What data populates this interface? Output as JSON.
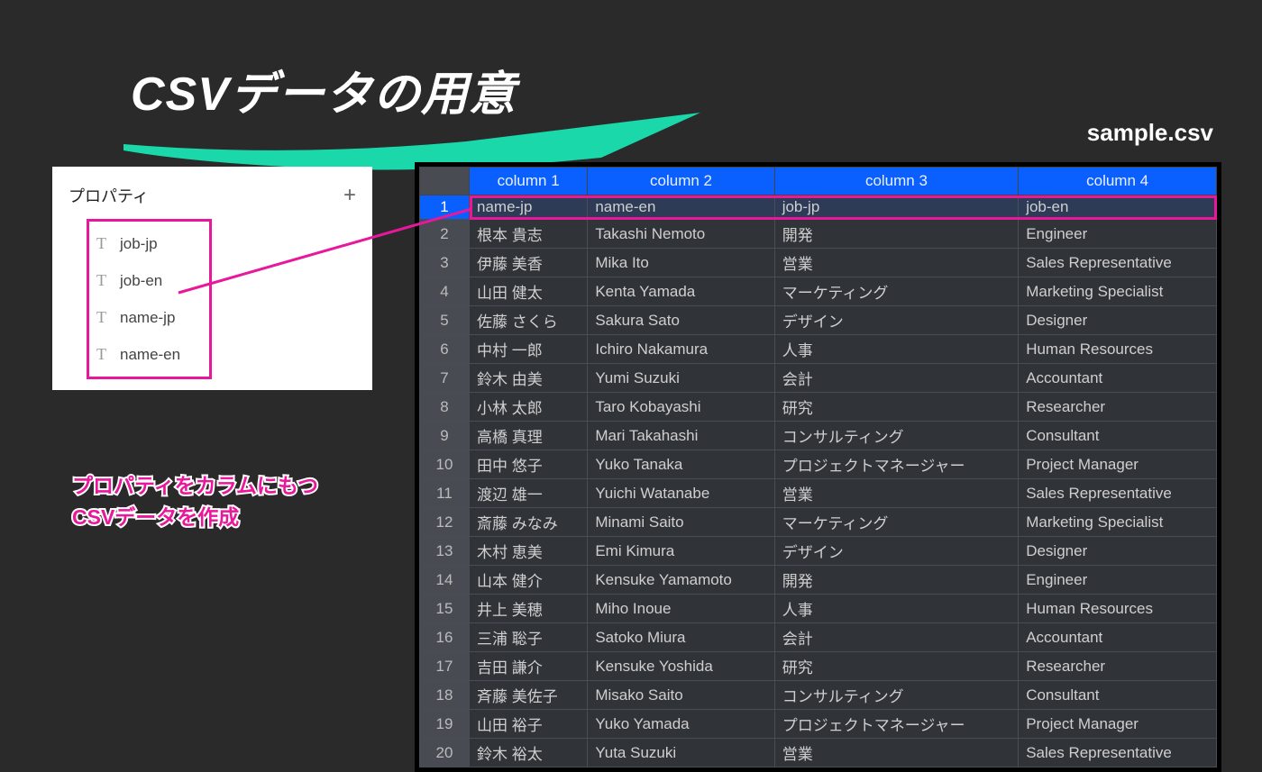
{
  "title": "CSVデータの用意",
  "filename": "sample.csv",
  "properties": {
    "header": "プロパティ",
    "items": [
      "job-jp",
      "job-en",
      "name-jp",
      "name-en"
    ]
  },
  "caption_line1": "プロパティをカラムにもつ",
  "caption_line2": "CSVデータを作成",
  "columns": [
    "column 1",
    "column 2",
    "column 3",
    "column 4"
  ],
  "rows": [
    {
      "n": "1",
      "c": [
        "name-jp",
        "name-en",
        "job-jp",
        "job-en"
      ],
      "hl": true
    },
    {
      "n": "2",
      "c": [
        "根本 貴志",
        "Takashi Nemoto",
        "開発",
        "Engineer"
      ]
    },
    {
      "n": "3",
      "c": [
        "伊藤 美香",
        "Mika Ito",
        "営業",
        "Sales Representative"
      ]
    },
    {
      "n": "4",
      "c": [
        "山田 健太",
        "Kenta Yamada",
        "マーケティング",
        "Marketing Specialist"
      ]
    },
    {
      "n": "5",
      "c": [
        "佐藤 さくら",
        "Sakura Sato",
        "デザイン",
        "Designer"
      ]
    },
    {
      "n": "6",
      "c": [
        "中村 一郎",
        "Ichiro Nakamura",
        "人事",
        "Human Resources"
      ]
    },
    {
      "n": "7",
      "c": [
        "鈴木 由美",
        "Yumi Suzuki",
        "会計",
        "Accountant"
      ]
    },
    {
      "n": "8",
      "c": [
        "小林 太郎",
        "Taro Kobayashi",
        "研究",
        "Researcher"
      ]
    },
    {
      "n": "9",
      "c": [
        "高橋 真理",
        "Mari Takahashi",
        "コンサルティング",
        "Consultant"
      ]
    },
    {
      "n": "10",
      "c": [
        "田中 悠子",
        "Yuko Tanaka",
        "プロジェクトマネージャー",
        "Project Manager"
      ]
    },
    {
      "n": "11",
      "c": [
        "渡辺 雄一",
        "Yuichi Watanabe",
        "営業",
        "Sales Representative"
      ]
    },
    {
      "n": "12",
      "c": [
        "斎藤 みなみ",
        "Minami Saito",
        "マーケティング",
        "Marketing Specialist"
      ]
    },
    {
      "n": "13",
      "c": [
        "木村 恵美",
        "Emi Kimura",
        "デザイン",
        "Designer"
      ]
    },
    {
      "n": "14",
      "c": [
        "山本 健介",
        "Kensuke Yamamoto",
        "開発",
        "Engineer"
      ]
    },
    {
      "n": "15",
      "c": [
        "井上 美穂",
        "Miho Inoue",
        "人事",
        "Human Resources"
      ]
    },
    {
      "n": "16",
      "c": [
        "三浦 聡子",
        "Satoko Miura",
        "会計",
        "Accountant"
      ]
    },
    {
      "n": "17",
      "c": [
        "吉田 謙介",
        "Kensuke Yoshida",
        "研究",
        "Researcher"
      ]
    },
    {
      "n": "18",
      "c": [
        "斉藤 美佐子",
        "Misako Saito",
        "コンサルティング",
        "Consultant"
      ]
    },
    {
      "n": "19",
      "c": [
        "山田 裕子",
        "Yuko Yamada",
        "プロジェクトマネージャー",
        "Project Manager"
      ]
    },
    {
      "n": "20",
      "c": [
        "鈴木 裕太",
        "Yuta Suzuki",
        "営業",
        "Sales Representative"
      ]
    }
  ]
}
